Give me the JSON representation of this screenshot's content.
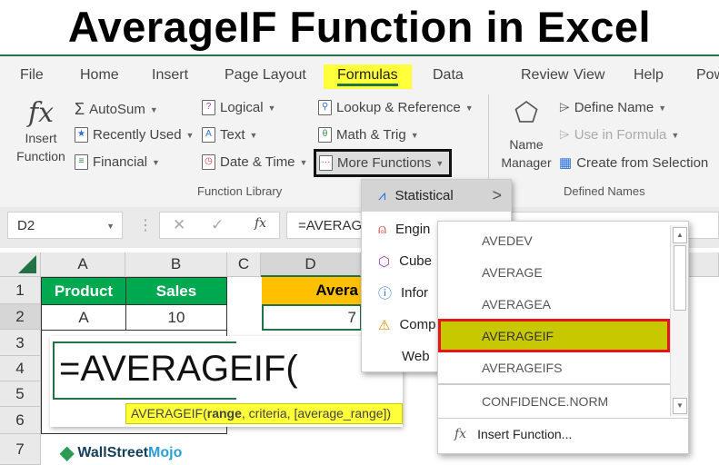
{
  "title": "AverageIF Function in Excel",
  "tabs": [
    "File",
    "Home",
    "Insert",
    "Page Layout",
    "Formulas",
    "Data",
    "Review",
    "View",
    "Help",
    "Pow"
  ],
  "ribbon": {
    "insert_function": [
      "Insert",
      "Function"
    ],
    "col1": [
      "AutoSum",
      "Recently Used",
      "Financial"
    ],
    "col2": [
      "Logical",
      "Text",
      "Date & Time"
    ],
    "col3": [
      "Lookup & Reference",
      "Math & Trig",
      "More Functions"
    ],
    "function_library": "Function Library",
    "name_manager": [
      "Name",
      "Manager"
    ],
    "defined": [
      "Define Name",
      "Use in Formula",
      "Create from Selection"
    ],
    "defined_names": "Defined Names"
  },
  "formula_bar": {
    "name_box": "D2",
    "formula": "=AVERAG",
    "fx": "fx"
  },
  "columns": [
    "A",
    "B",
    "C",
    "D"
  ],
  "rows": [
    "1",
    "2",
    "3",
    "4",
    "5",
    "6",
    "7"
  ],
  "cells": {
    "A1": "Product",
    "B1": "Sales",
    "D1": "Avera",
    "A2": "A",
    "B2": "10",
    "D2": "7"
  },
  "edit": {
    "formula": "=AVERAGEIF(",
    "tooltip_fn": "AVERAGEIF(",
    "tooltip_arg1": "range",
    "tooltip_rest": ", criteria, [average_range])"
  },
  "menu": [
    "Statistical",
    "Engin",
    "Cube",
    "Infor",
    "Comp",
    "Web"
  ],
  "submenu": [
    "AVEDEV",
    "AVERAGE",
    "AVERAGEA",
    "AVERAGEIF",
    "AVERAGEIFS",
    "CONFIDENCE.NORM"
  ],
  "insert_function_item": "Insert Function...",
  "logo": {
    "wall": "WallStreet",
    "mojo": "Mojo"
  },
  "colors": {
    "excel_green": "#217346",
    "header_green": "#00a850",
    "header_orange": "#ffc000",
    "highlight": "#c8c800",
    "tab_highlight": "#ffff3a"
  }
}
